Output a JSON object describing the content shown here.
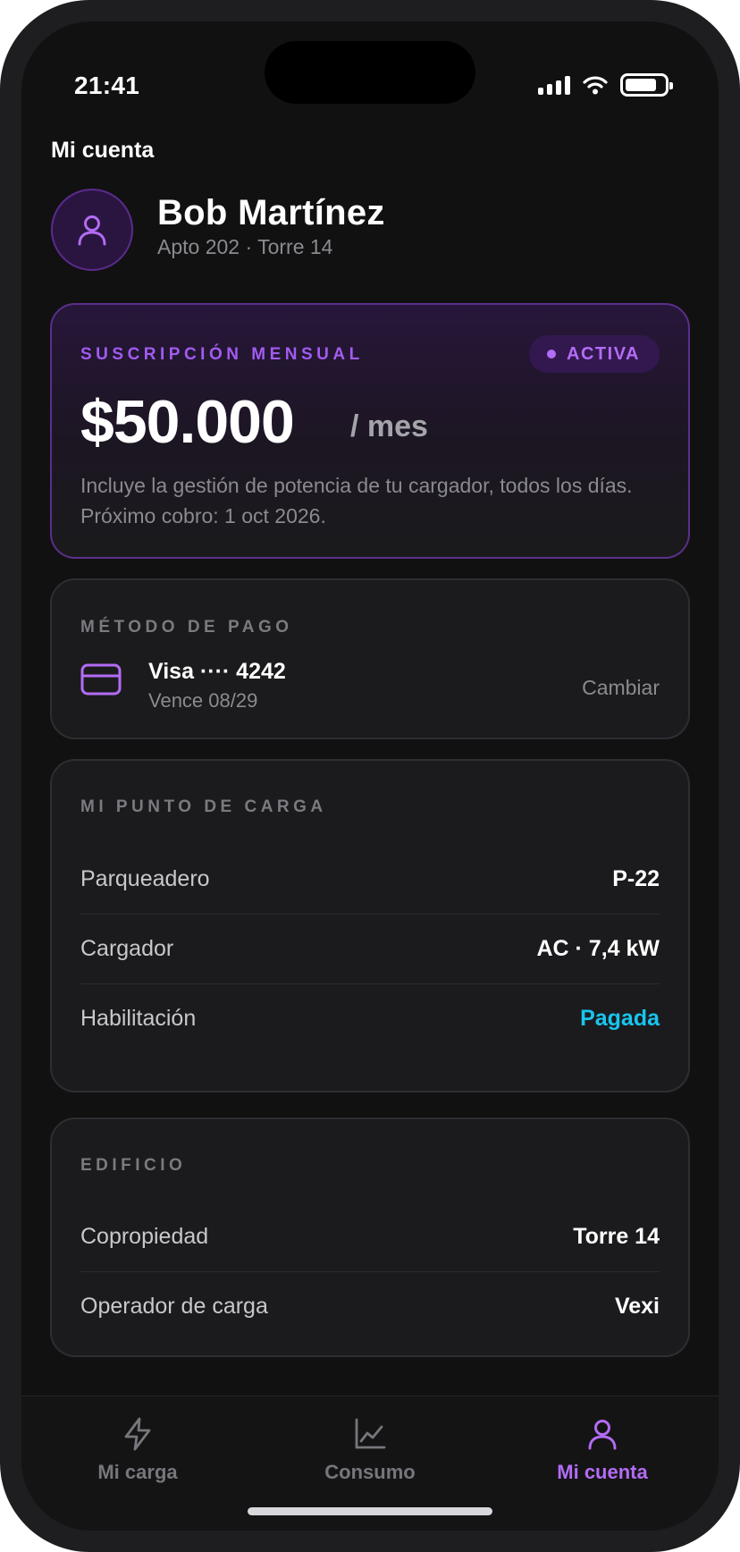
{
  "status_bar": {
    "time": "21:41"
  },
  "page": {
    "title": "Mi cuenta"
  },
  "profile": {
    "name": "Bob Martínez",
    "subtitle": "Apto 202 · Torre 14"
  },
  "subscription": {
    "eyebrow": "SUSCRIPCIÓN MENSUAL",
    "badge": "ACTIVA",
    "price": "$50.000",
    "unit": "/ mes",
    "description": "Incluye la gestión de potencia de tu cargador, todos los días. Próximo cobro: 1 oct 2026."
  },
  "payment": {
    "eyebrow": "MÉTODO DE PAGO",
    "card_label": "Visa ···· 4242",
    "expiry": "Vence 08/29",
    "change_label": "Cambiar"
  },
  "charging_point": {
    "eyebrow": "MI PUNTO DE CARGA",
    "rows": [
      {
        "label": "Parqueadero",
        "value": "P-22"
      },
      {
        "label": "Cargador",
        "value": "AC · 7,4 kW"
      },
      {
        "label": "Habilitación",
        "value": "Pagada"
      }
    ]
  },
  "building": {
    "eyebrow": "EDIFICIO",
    "rows": [
      {
        "label": "Copropiedad",
        "value": "Torre 14"
      },
      {
        "label": "Operador de carga",
        "value": "Vexi"
      }
    ]
  },
  "tabs": [
    {
      "label": "Mi carga",
      "icon": "bolt-icon",
      "active": false
    },
    {
      "label": "Consumo",
      "icon": "chart-icon",
      "active": false
    },
    {
      "label": "Mi cuenta",
      "icon": "user-icon",
      "active": true
    }
  ],
  "colors": {
    "accent": "#b36cf5",
    "highlight": "#18c5ef",
    "background": "#111112"
  }
}
